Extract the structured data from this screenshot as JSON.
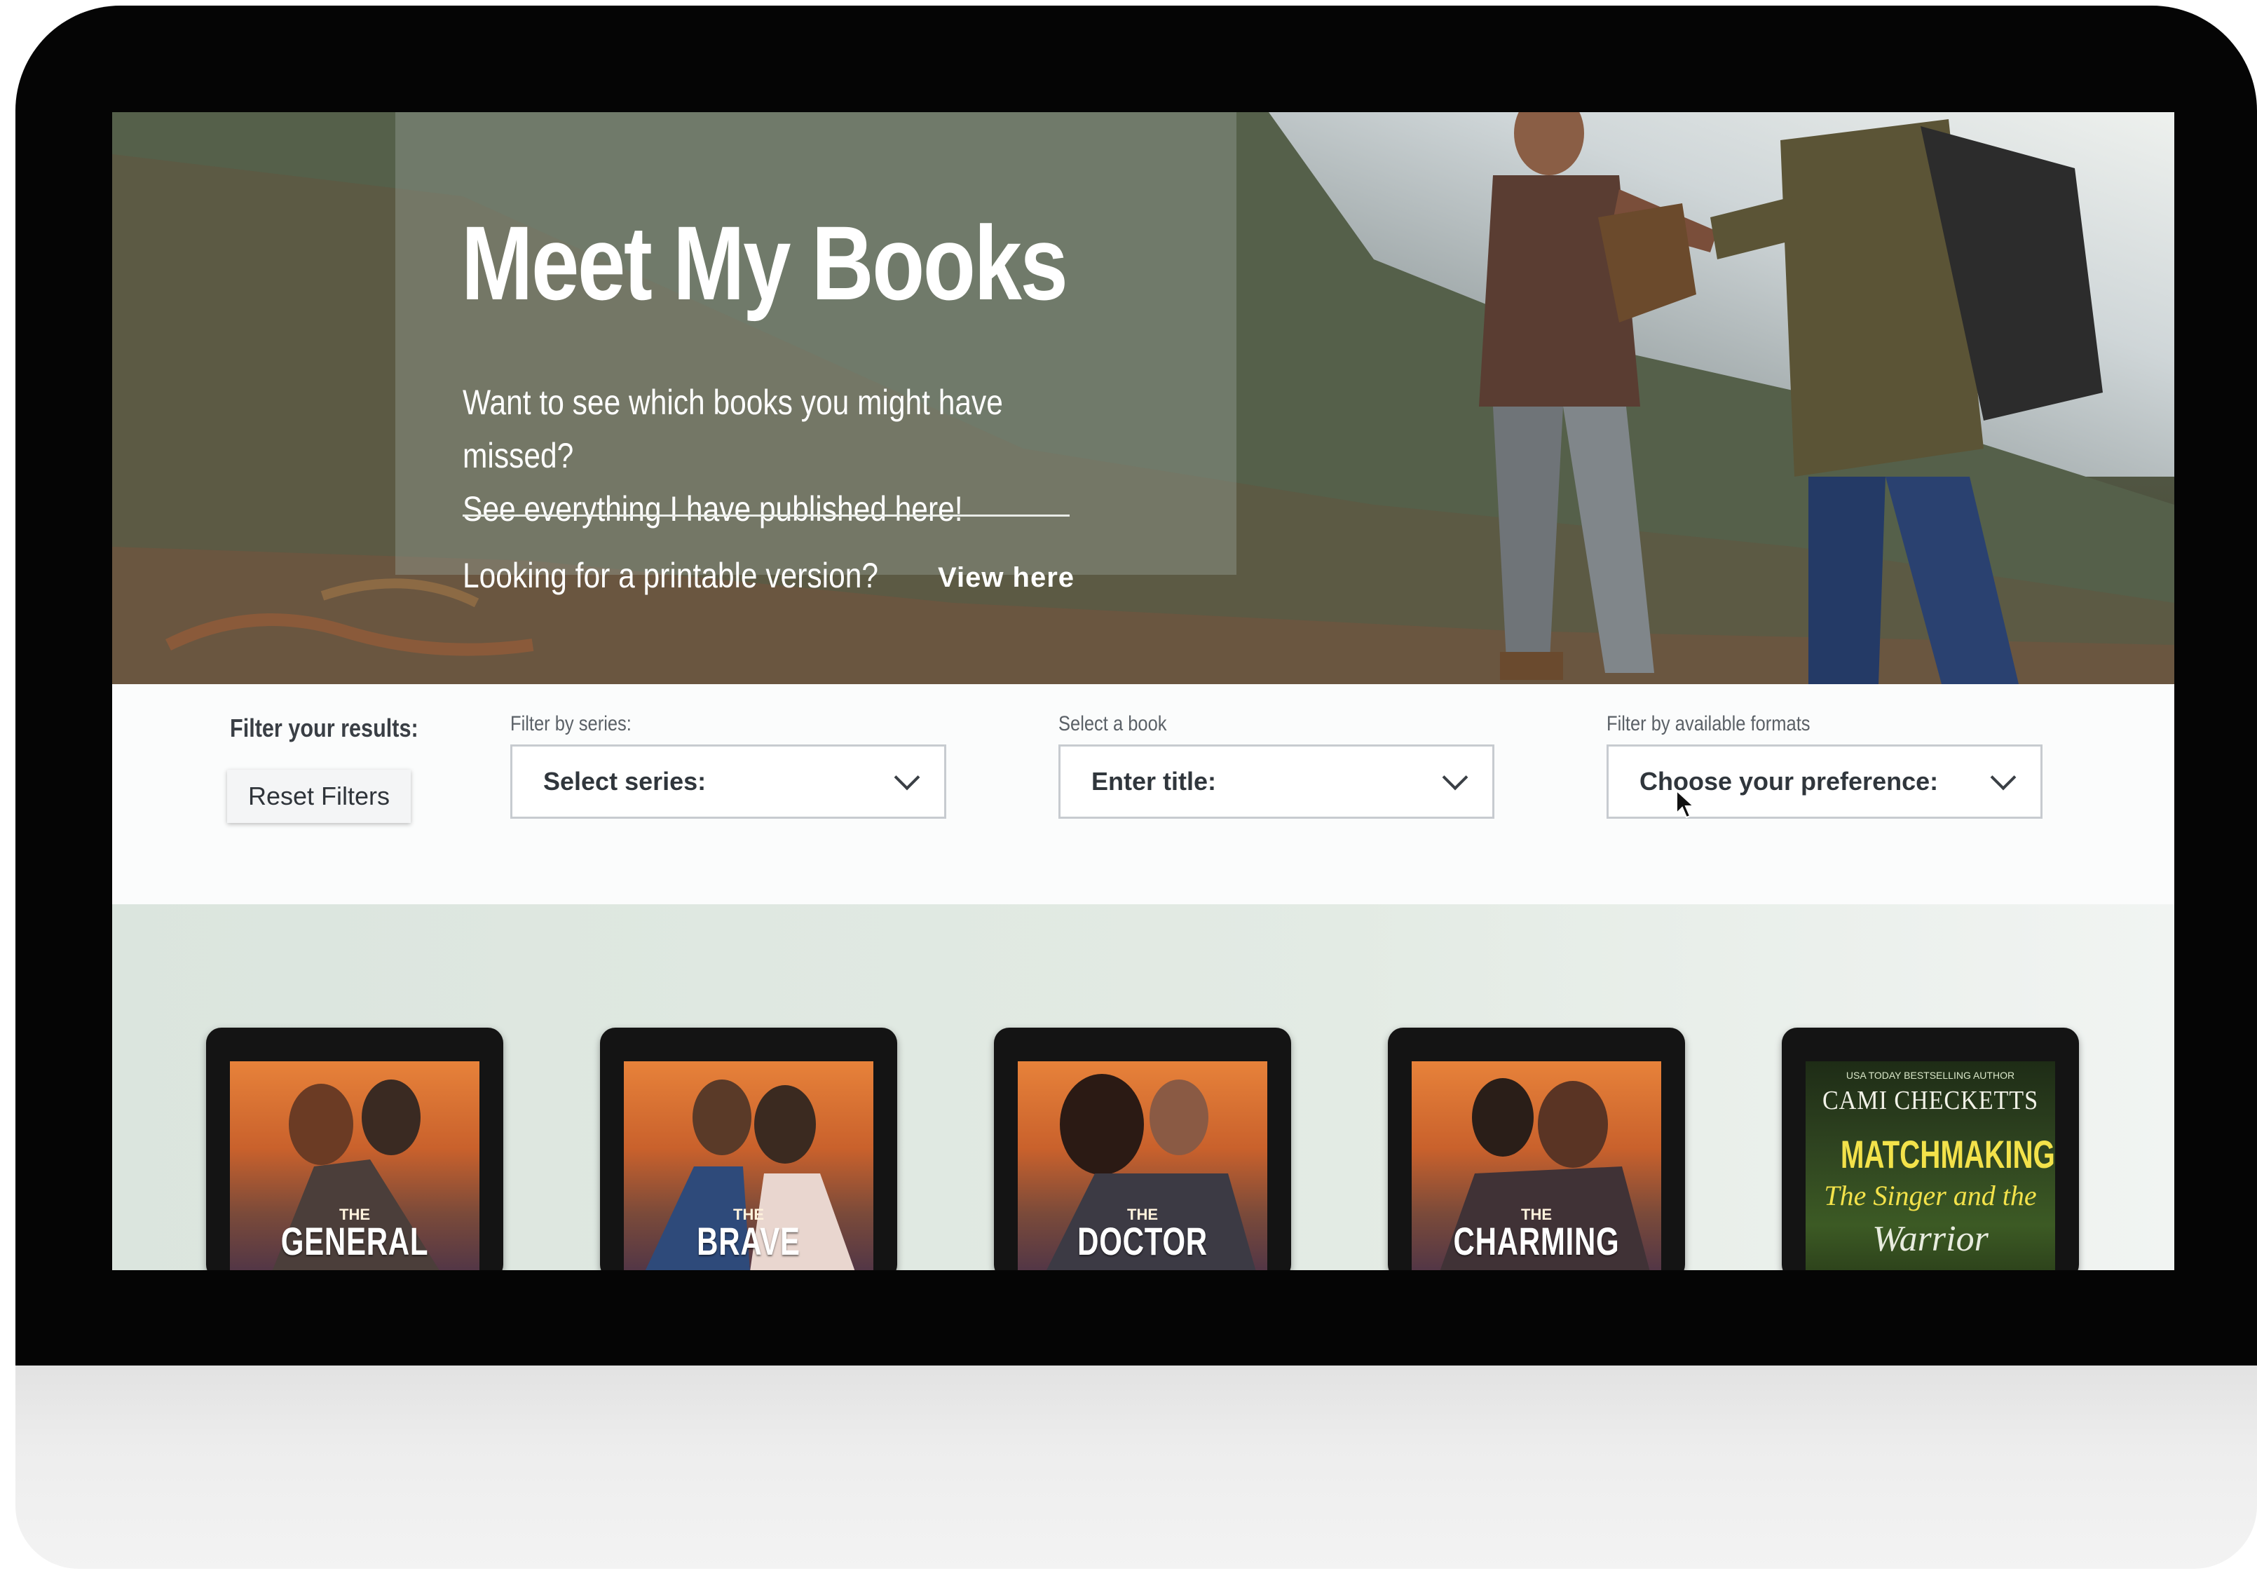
{
  "hero": {
    "title": "Meet My Books",
    "subtitle_line1": "Want to see which books you might have missed?",
    "subtitle_line2": "See everything I have published here!",
    "printable_text": "Looking for a printable version?",
    "view_link": "View here"
  },
  "filters": {
    "title": "Filter your results:",
    "reset_label": "Reset Filters",
    "series": {
      "label": "Filter by series:",
      "value": "Select series:"
    },
    "book": {
      "label": "Select a book",
      "value": "Enter title:"
    },
    "format": {
      "label": "Filter by available formats",
      "value": "Choose your preference:"
    }
  },
  "books": [
    {
      "the": "THE",
      "title": "GENERAL PRINCE"
    },
    {
      "the": "THE",
      "title": "BRAVE PRINCE"
    },
    {
      "the": "THE",
      "title": "DOCTOR PRINCE"
    },
    {
      "the": "THE",
      "title": "CHARMING PRINCE"
    },
    {
      "tagline": "USA TODAY BESTSELLING AUTHOR",
      "author": "CAMI CHECKETTS",
      "title": "MATCHMAKING",
      "subtitle1": "The Singer and the",
      "subtitle2": "Warrior"
    }
  ],
  "icons": [
    "chevron-down-icon",
    "mouse-cursor-icon"
  ],
  "colors": {
    "hero_text": "#ffffff",
    "select_border": "#c7cbd0",
    "cover_accent": "#f3e24a"
  }
}
